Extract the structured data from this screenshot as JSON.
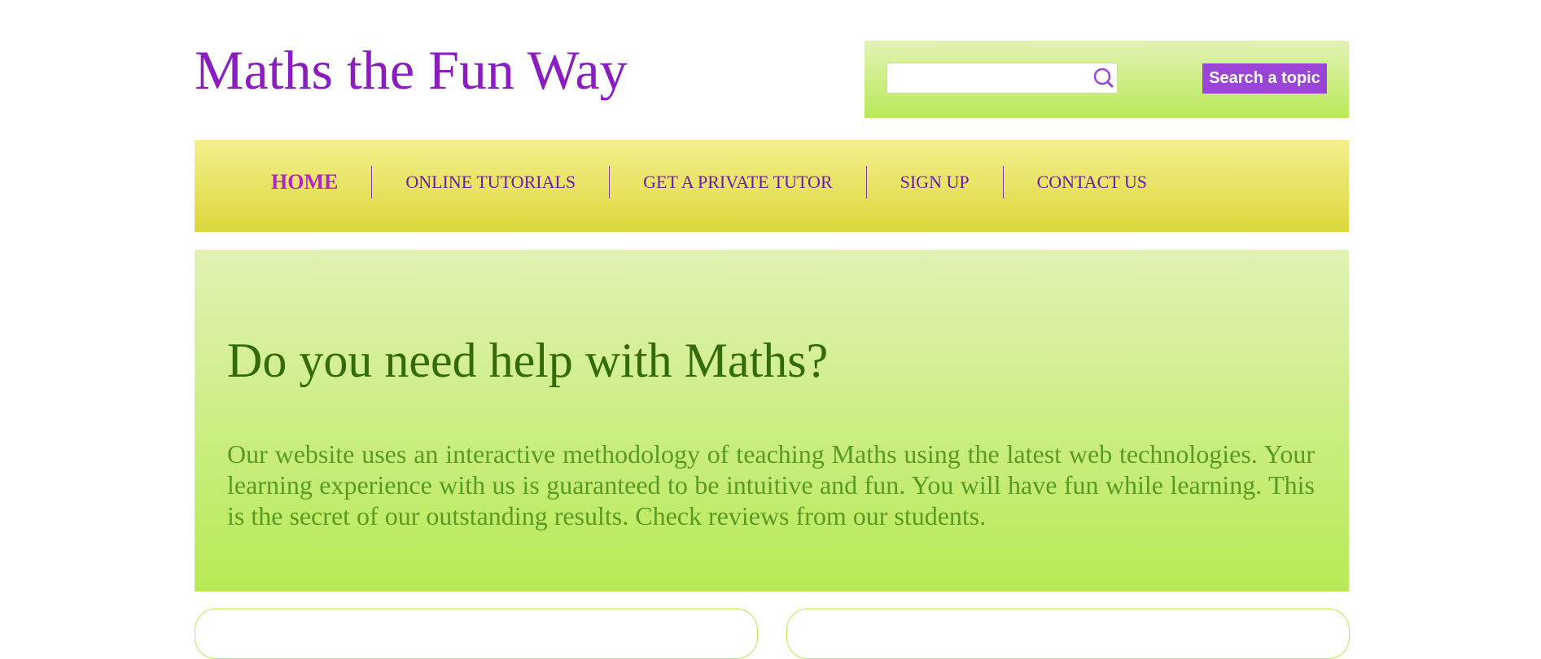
{
  "header": {
    "site_title": "Maths the Fun Way"
  },
  "search": {
    "value": "",
    "placeholder": "",
    "button_label": "Search a topic",
    "icon": "search-icon"
  },
  "nav": {
    "items": [
      {
        "label": "HOME",
        "active": true
      },
      {
        "label": "ONLINE TUTORIALS",
        "active": false
      },
      {
        "label": "GET A PRIVATE TUTOR",
        "active": false
      },
      {
        "label": "SIGN UP",
        "active": false
      },
      {
        "label": "CONTACT US",
        "active": false
      }
    ]
  },
  "hero": {
    "title": "Do you need help with Maths?",
    "text": "Our website uses an interactive methodology of teaching Maths using the latest web technologies. Your learning experience with us is guaranteed to be intuitive and fun. You will have fun while learning. This is the secret of our outstanding results. Check reviews from our students."
  },
  "colors": {
    "brand_purple": "#8a1cc0",
    "nav_yellow": "#dcd73a",
    "hero_green": "#b7ea55",
    "heading_green": "#356a08"
  }
}
